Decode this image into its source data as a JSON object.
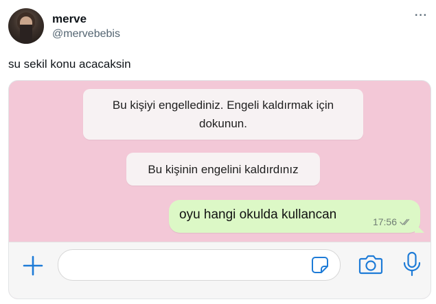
{
  "tweet": {
    "display_name": "merve",
    "handle": "@mervebebis",
    "text": "su sekil konu acacaksin",
    "more_icon": "more-dots-icon",
    "avatar": "avatar"
  },
  "chat": {
    "system_messages": [
      "Bu kişiyi engellediniz. Engeli kaldırmak için dokunun.",
      "Bu kişinin engelini kaldırdınız"
    ],
    "outgoing_message": {
      "text": "oyu hangi okulda kullancan",
      "time": "17:56",
      "status_icon": "double-check-icon"
    },
    "input_bar": {
      "field_value": "",
      "icons": [
        "plus-icon",
        "sticker-icon",
        "camera-icon",
        "microphone-icon"
      ]
    },
    "colors": {
      "background": "#f3c8d7",
      "outgoing_bubble": "#dcf8c6",
      "system_bubble": "#f7f2f3",
      "accent": "#1d7bd7"
    }
  }
}
